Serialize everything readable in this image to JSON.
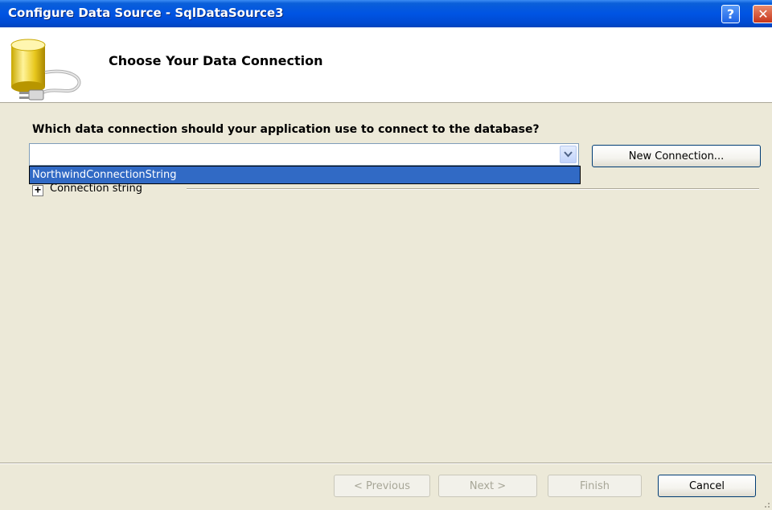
{
  "window": {
    "title": "Configure Data Source - SqlDataSource3",
    "help_glyph": "?",
    "close_glyph": "✕"
  },
  "header": {
    "title": "Choose Your Data Connection",
    "icon": "database-plug-icon"
  },
  "main": {
    "question": "Which data connection should your application use to connect to the database?",
    "connection_combo": {
      "value": "",
      "options": [
        "NorthwindConnectionString"
      ],
      "highlighted_option": "NorthwindConnectionString"
    },
    "new_connection_label": "New Connection...",
    "connection_string_expander_glyph": "+",
    "connection_string_label": "Connection string"
  },
  "footer": {
    "previous_label": "< Previous",
    "next_label": "Next >",
    "finish_label": "Finish",
    "cancel_label": "Cancel"
  },
  "colors": {
    "titlebar": "#0054e3",
    "selection": "#316ac5",
    "dialog_background": "#ece9d8"
  }
}
